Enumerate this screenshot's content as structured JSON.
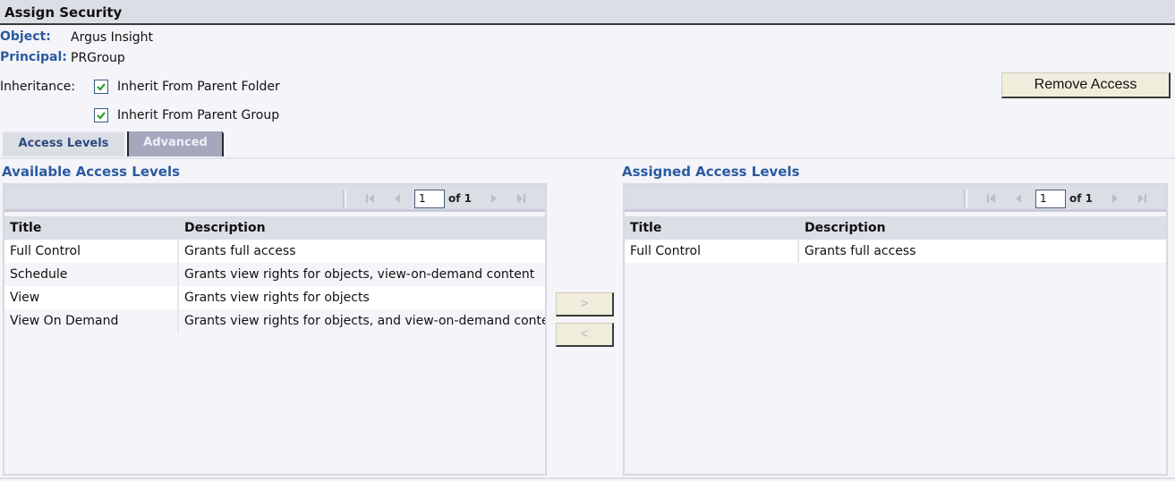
{
  "header": {
    "title": "Assign Security"
  },
  "details": {
    "object_label": "Object:",
    "object_value": "Argus Insight",
    "principal_label": "Principal:",
    "principal_value": "PRGroup",
    "inheritance_label": "Inheritance:"
  },
  "inheritance": [
    {
      "label": "Inherit From Parent Folder",
      "checked": true
    },
    {
      "label": "Inherit From Parent Group",
      "checked": true
    }
  ],
  "buttons": {
    "remove_access": "Remove Access",
    "move_right": ">",
    "move_left": "<"
  },
  "tabs": [
    {
      "label": "Access Levels",
      "active": true
    },
    {
      "label": "Advanced",
      "active": false
    }
  ],
  "available": {
    "title": "Available Access Levels",
    "pager": {
      "page": "1",
      "of_text": "of 1"
    },
    "columns": [
      "Title",
      "Description"
    ],
    "rows": [
      {
        "title": "Full Control",
        "description": "Grants full access"
      },
      {
        "title": "Schedule",
        "description": "Grants view rights for objects, view-on-demand content"
      },
      {
        "title": "View",
        "description": "Grants view rights for objects"
      },
      {
        "title": "View On Demand",
        "description": "Grants view rights for objects, and view-on-demand content"
      }
    ]
  },
  "assigned": {
    "title": "Assigned Access Levels",
    "pager": {
      "page": "1",
      "of_text": "of 1"
    },
    "columns": [
      "Title",
      "Description"
    ],
    "rows": [
      {
        "title": "Full Control",
        "description": "Grants full access"
      }
    ]
  },
  "colors": {
    "accent_blue": "#2c5aa0",
    "header_bg": "#dcdee6",
    "button_bg": "#f1eddc",
    "check_green": "#2aa02a"
  }
}
